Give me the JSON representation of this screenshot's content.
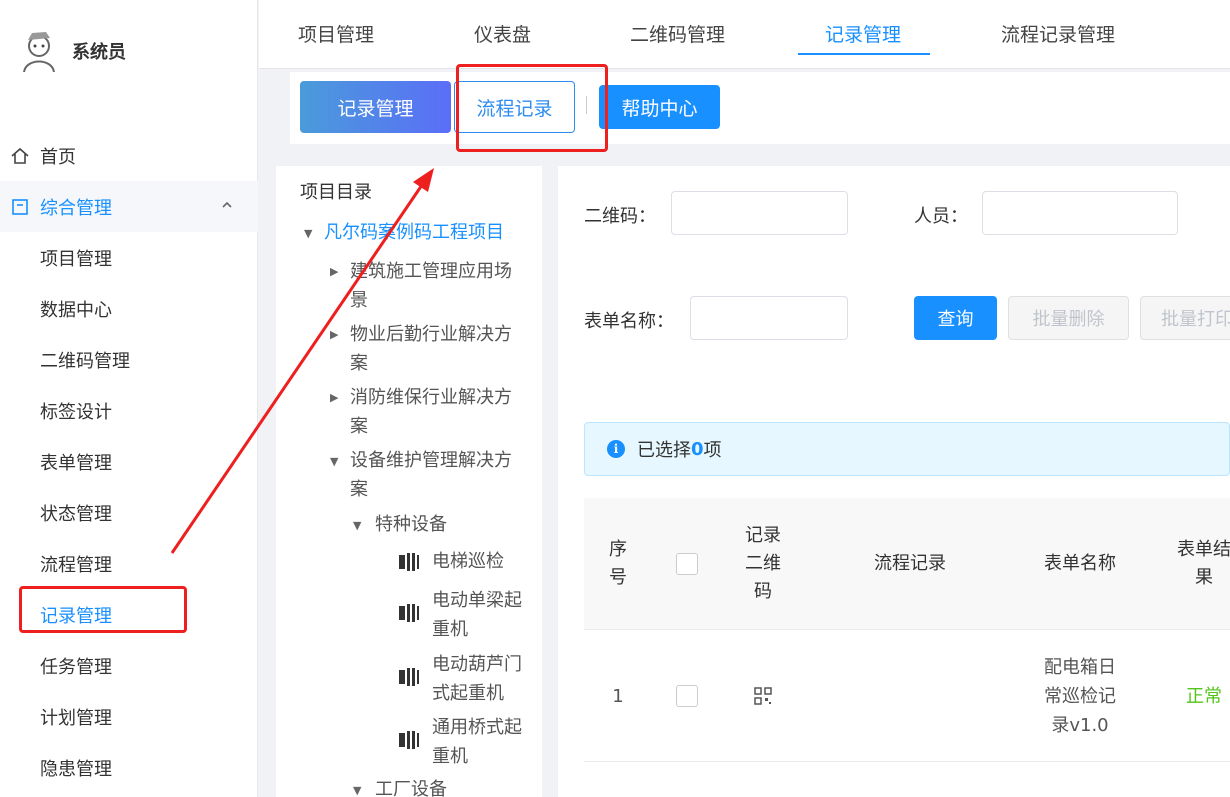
{
  "user": {
    "name": "系统员"
  },
  "sidebar": {
    "home": "首页",
    "group": "综合管理",
    "items": [
      "项目管理",
      "数据中心",
      "二维码管理",
      "标签设计",
      "表单管理",
      "状态管理",
      "流程管理",
      "记录管理",
      "任务管理",
      "计划管理",
      "隐患管理"
    ],
    "active_item": "记录管理"
  },
  "top_tabs": [
    "项目管理",
    "仪表盘",
    "二维码管理",
    "记录管理",
    "流程记录管理"
  ],
  "active_top_tab": "记录管理",
  "subbar": {
    "records": "记录管理",
    "flow": "流程记录",
    "help": "帮助中心"
  },
  "tree": {
    "title": "项目目录",
    "root": "凡尔码案例码工程项目",
    "nodes": {
      "n1a": "建筑施工管理应用场",
      "n1b": "景",
      "n2a": "物业后勤行业解决方",
      "n2b": "案",
      "n3a": "消防维保行业解决方",
      "n3b": "案",
      "n4a": "设备维护管理解决方",
      "n4b": "案",
      "special": "特种设备",
      "leaf1": "电梯巡检",
      "leaf2a": "电动单梁起",
      "leaf2b": "重机",
      "leaf3a": "电动葫芦门",
      "leaf3b": "式起重机",
      "leaf4a": "通用桥式起",
      "leaf4b": "重机",
      "factory": "工厂设备"
    }
  },
  "filters": {
    "qr_label": "二维码：",
    "person_label": "人员：",
    "form_label": "表单名称：",
    "query": "查询",
    "batch_delete": "批量删除",
    "batch_print": "批量打印"
  },
  "alert": {
    "prefix": "已选择",
    "count": "0",
    "suffix": "项"
  },
  "table": {
    "headers": {
      "seq_a": "序",
      "seq_b": "号",
      "qr_a": "记录",
      "qr_b": "二维",
      "qr_c": "码",
      "flow": "流程记录",
      "form": "表单名称",
      "result_a": "表单结",
      "result_b": "果"
    },
    "rows": [
      {
        "seq": "1",
        "form_a": "配电箱日",
        "form_b": "常巡检记",
        "form_c": "录v1.0",
        "result": "正常"
      }
    ]
  },
  "colors": {
    "accent": "#1890ff",
    "annotation": "#ee1f1f",
    "ok": "#52c41a"
  }
}
